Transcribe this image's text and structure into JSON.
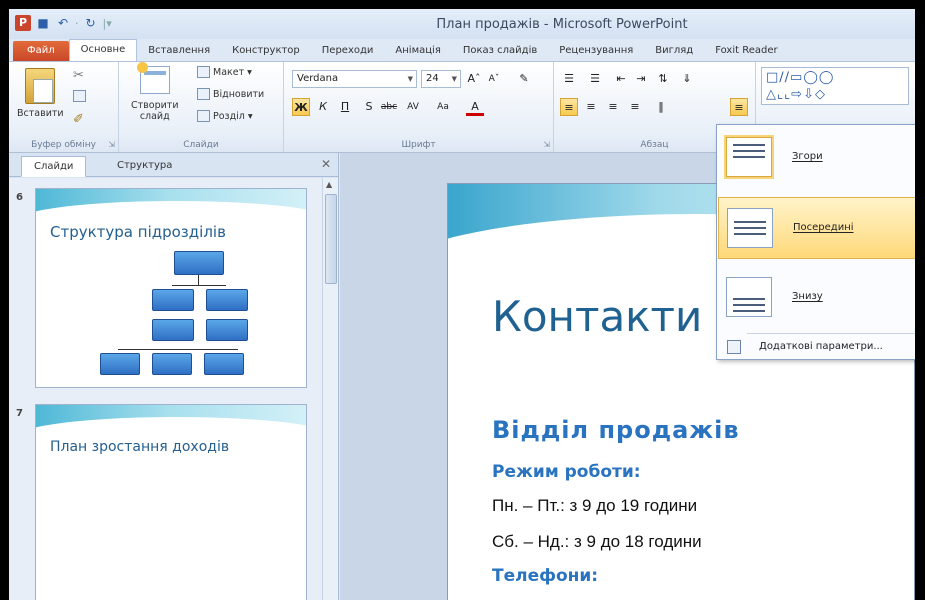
{
  "app": {
    "title": "План продажів - Microsoft PowerPoint",
    "logo_letter": "P"
  },
  "tabs": [
    {
      "label": "Файл",
      "kind": "file"
    },
    {
      "label": "Основне",
      "kind": "active"
    },
    {
      "label": "Вставлення",
      "kind": ""
    },
    {
      "label": "Конструктор",
      "kind": ""
    },
    {
      "label": "Переходи",
      "kind": ""
    },
    {
      "label": "Анімація",
      "kind": ""
    },
    {
      "label": "Показ слайдів",
      "kind": ""
    },
    {
      "label": "Рецензування",
      "kind": ""
    },
    {
      "label": "Вигляд",
      "kind": ""
    },
    {
      "label": "Foxit Reader",
      "kind": ""
    }
  ],
  "ribbon": {
    "clipboard": {
      "paste": "Вставити",
      "group": "Буфер обміну"
    },
    "slides": {
      "new_slide_1": "Створити",
      "new_slide_2": "слайд",
      "layout": "Макет",
      "reset": "Відновити",
      "section": "Розділ",
      "group": "Слайди"
    },
    "font": {
      "family": "Verdana",
      "size": "24",
      "group": "Шрифт"
    },
    "paragraph": {
      "group": "Абзац"
    }
  },
  "left_pane": {
    "tab_slides": "Слайди",
    "tab_outline": "Структура",
    "slides": [
      {
        "number": "6",
        "title": "Структура підрозділів"
      },
      {
        "number": "7",
        "title": "План зростання доходів"
      }
    ]
  },
  "slide": {
    "title": "Контакти",
    "section": "Відділ продажів",
    "work_hours_label": "Режим роботи:",
    "weekday_hours": "Пн. – Пт.: з 9 до 19 години",
    "weekend_hours": "Сб. – Нд.: з 9 до 18 години",
    "phones_label": "Телефони:"
  },
  "align_dropdown": {
    "items": [
      {
        "label": "Згори",
        "state": "selected"
      },
      {
        "label": "Посередині",
        "state": "hover"
      },
      {
        "label": "Знизу",
        "state": ""
      }
    ],
    "more": "Додаткові параметри..."
  }
}
